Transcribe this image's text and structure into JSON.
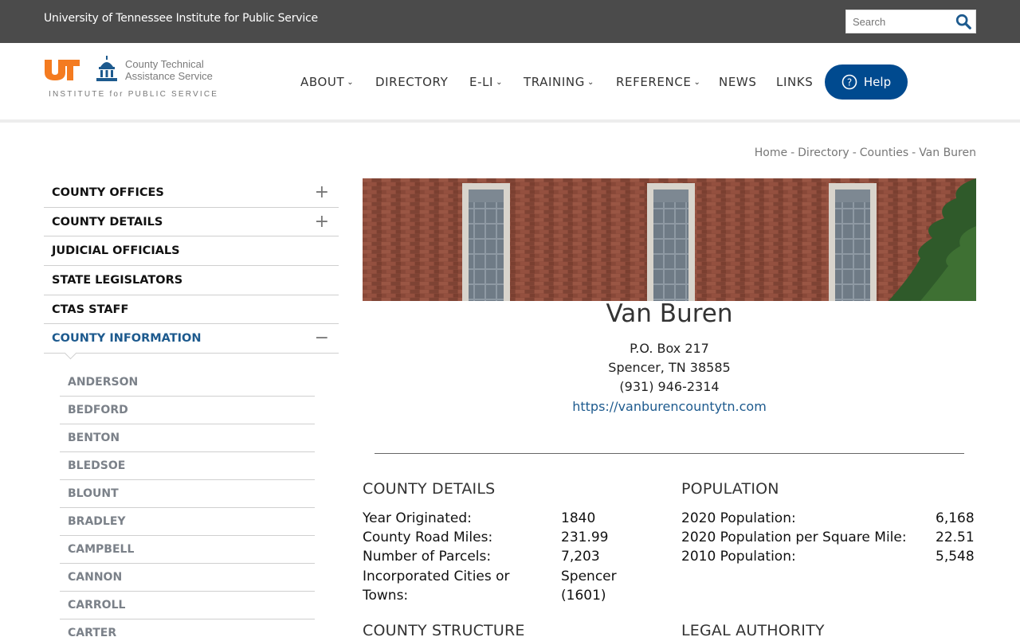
{
  "topbar": {
    "institute": "University of Tennessee Institute for Public Service",
    "search_placeholder": "Search"
  },
  "logo": {
    "ctas_line1": "County Technical",
    "ctas_line2": "Assistance Service",
    "ips": "INSTITUTE for PUBLIC SERVICE",
    "colors": {
      "ut_orange": "#f47b20",
      "ctas_blue": "#1d5a8e"
    }
  },
  "nav": {
    "about": "ABOUT",
    "directory": "DIRECTORY",
    "eli": "E-LI",
    "training": "TRAINING",
    "reference": "REFERENCE",
    "news": "NEWS",
    "links": "LINKS",
    "help": "Help"
  },
  "breadcrumb": [
    "Home",
    "Directory",
    "Counties",
    "Van Buren"
  ],
  "sidebar": {
    "items": [
      {
        "label": "COUNTY OFFICES",
        "toggle": "+"
      },
      {
        "label": "COUNTY DETAILS",
        "toggle": "+"
      },
      {
        "label": "JUDICIAL OFFICIALS"
      },
      {
        "label": "STATE LEGISLATORS"
      },
      {
        "label": "CTAS STAFF"
      },
      {
        "label": "COUNTY INFORMATION",
        "toggle": "−"
      }
    ],
    "counties": [
      "ANDERSON",
      "BEDFORD",
      "BENTON",
      "BLEDSOE",
      "BLOUNT",
      "BRADLEY",
      "CAMPBELL",
      "CANNON",
      "CARROLL",
      "CARTER"
    ]
  },
  "county": {
    "name": "Van Buren",
    "address1": "P.O. Box 217",
    "address2": "Spencer, TN 38585",
    "phone": "(931) 946-2314",
    "website": "https://vanburencountytn.com"
  },
  "details": {
    "heading": "COUNTY DETAILS",
    "year_label": "Year Originated:",
    "year_value": "1840",
    "road_label": "County Road Miles:",
    "road_value": "231.99",
    "parcels_label": "Number of Parcels:",
    "parcels_value": "7,203",
    "cities_label_1": "Incorporated Cities or",
    "cities_label_2": "Towns:",
    "cities_value_1": "Spencer",
    "cities_value_2": "(1601)"
  },
  "population": {
    "heading": "POPULATION",
    "pop2020_label": "2020 Population:",
    "pop2020_value": "6,168",
    "density_label": "2020 Population per Square Mile:",
    "density_value": "22.51",
    "pop2010_label": "2010 Population:",
    "pop2010_value": "5,548"
  },
  "more": {
    "structure": "COUNTY STRUCTURE",
    "legal": "LEGAL AUTHORITY"
  }
}
